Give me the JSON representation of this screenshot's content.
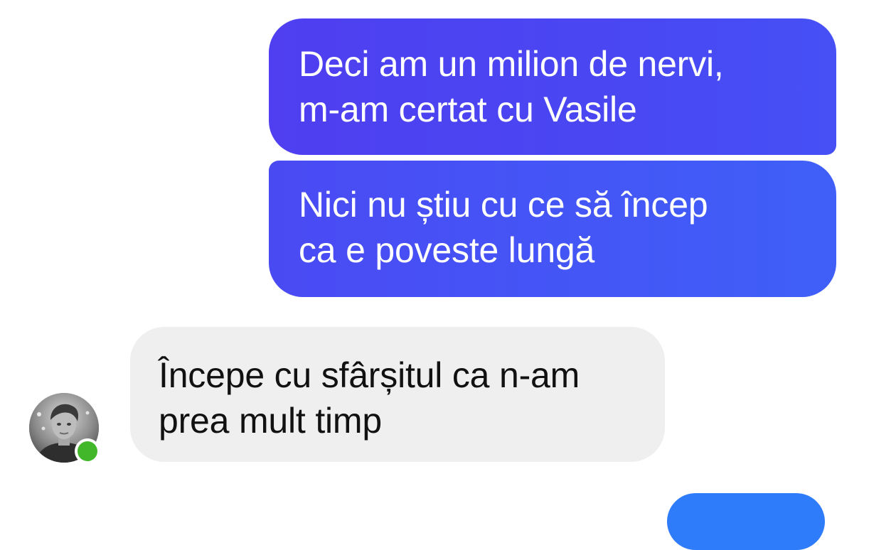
{
  "messages": {
    "outgoing_1": "Deci am un milion de nervi,\nm-am certat cu Vasile",
    "outgoing_2": "Nici nu știu cu ce să încep\nca e poveste lungă",
    "incoming_1": "Începe cu sfârșitul ca n-am\nprea mult timp"
  },
  "contact": {
    "avatar_icon": "person-photo-icon",
    "status": "online"
  },
  "colors": {
    "outgoing_bubble": "#4a46f2",
    "incoming_bubble": "#efefef",
    "presence": "#42b72a"
  }
}
